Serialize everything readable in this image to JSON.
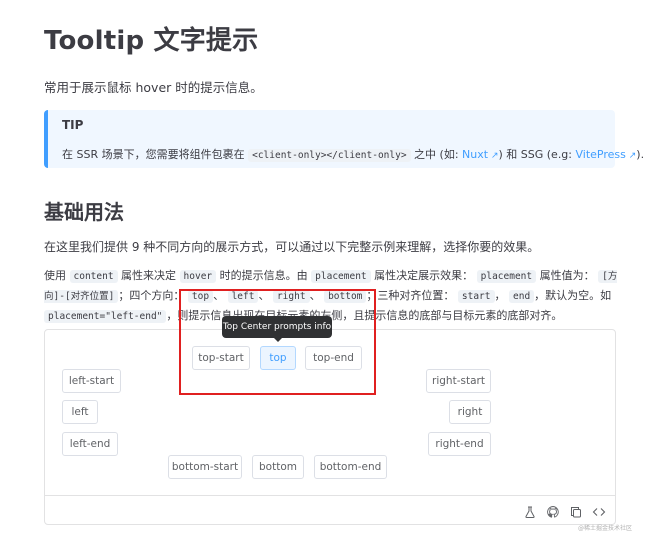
{
  "page": {
    "title": "Tooltip 文字提示",
    "intro": "常用于展示鼠标 hover 时的提示信息。"
  },
  "tip": {
    "title": "TIP",
    "text_before": "在 SSR 场景下，您需要将组件包裹在 ",
    "code": "<client-only></client-only>",
    "text_mid": " 之中 (如: ",
    "link1": "Nuxt",
    "text_mid2": ") 和 SSG (e.g: ",
    "link2": "VitePress",
    "text_end": ")."
  },
  "section": {
    "heading": "基础用法",
    "p1": "在这里我们提供 9 种不同方向的展示方式，可以通过以下完整示例来理解，选择你要的效果。",
    "p2": {
      "t1": "使用 ",
      "c1": "content",
      "t2": " 属性来决定 ",
      "c2": "hover",
      "t3": " 时的提示信息。由 ",
      "c3": "placement",
      "t4": " 属性决定展示效果： ",
      "c4": "placement",
      "t5": " 属性值为： ",
      "c5": "[方向]-[对齐位置]",
      "t6": "；四个方向： ",
      "c6": "top",
      "t7": "、 ",
      "c7": "left",
      "t8": "、 ",
      "c8": "right",
      "t9": "、 ",
      "c9": "bottom",
      "t10": "；三种对齐位置： ",
      "c10": "start",
      "t11": "， ",
      "c11": "end",
      "t12": "，默认为空。如 ",
      "c12": "placement=\"left-end\"",
      "t13": "，则提示信息出现在目标元素的左侧，且提示信息的底部与目标元素的底部对齐。"
    }
  },
  "demo": {
    "buttons": {
      "top_start": "top-start",
      "top": "top",
      "top_end": "top-end",
      "left_start": "left-start",
      "left": "left",
      "left_end": "left-end",
      "right_start": "right-start",
      "right": "right",
      "right_end": "right-end",
      "bottom_start": "bottom-start",
      "bottom": "bottom",
      "bottom_end": "bottom-end"
    },
    "tooltip": "Top Center prompts info",
    "toolbar_icons": [
      "flask-icon",
      "github-icon",
      "copy-icon",
      "code-icon"
    ]
  },
  "colors": {
    "accent": "#409eff",
    "tooltip_bg": "#303133",
    "highlight": "#e02020"
  },
  "watermark": "@稀土掘金技术社区"
}
